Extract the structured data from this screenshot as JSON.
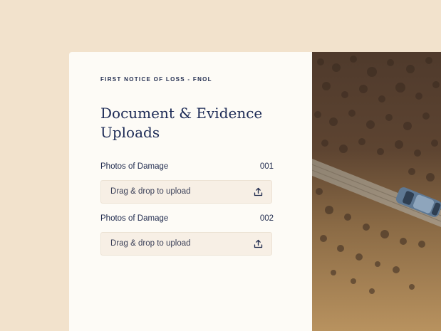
{
  "form": {
    "eyebrow": "FIRST NOTICE OF LOSS - FNOL",
    "title": "Document & Evidence Uploads",
    "fields": [
      {
        "label": "Photos of Damage",
        "code": "001",
        "upload_label": "Drag & drop to upload",
        "icon": "upload-icon"
      },
      {
        "label": "Photos of Damage",
        "code": "002",
        "upload_label": "Drag & drop to upload",
        "icon": "upload-icon"
      }
    ]
  },
  "theme": {
    "page_background": "#f2e2cc",
    "card_background": "#fdfbf6",
    "navy": "#1c2a55",
    "upload_background": "#f7efe5"
  }
}
